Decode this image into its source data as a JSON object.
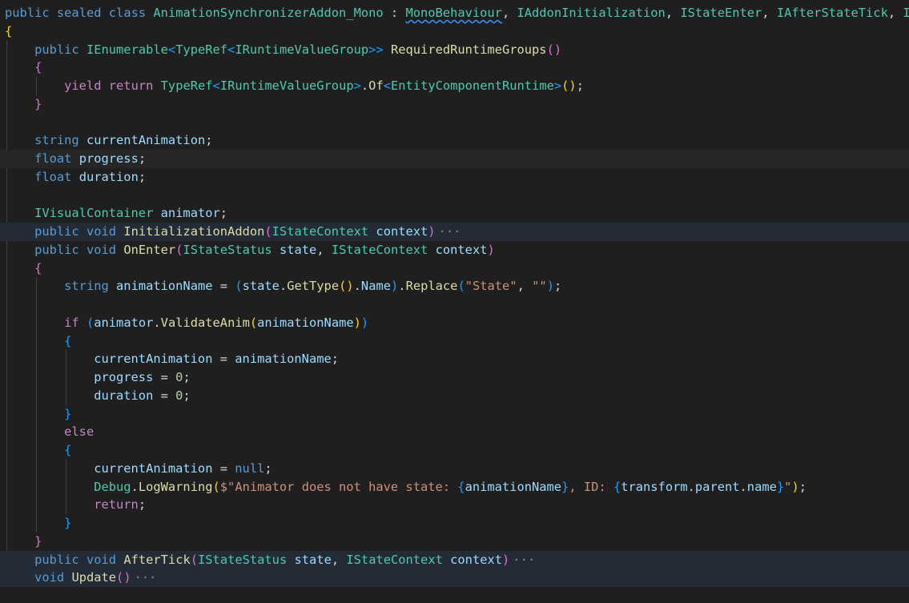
{
  "colors": {
    "keyword": "#569cd6",
    "control": "#c586c0",
    "type": "#4ec9b0",
    "method": "#dcdcaa",
    "variable": "#9cdcfe",
    "plain": "#d4d4d4",
    "string": "#ce9178",
    "number": "#b5cea8",
    "punct": "#d4d4d4",
    "brace1": "#ffd700",
    "brace2": "#da70d6",
    "brace3": "#179fff",
    "fold": "#8c8c8c",
    "background": "#1f1f1f"
  },
  "lines": [
    {
      "hl": "",
      "tokens": [
        [
          "keyword",
          "public"
        ],
        [
          "plain",
          " "
        ],
        [
          "keyword",
          "sealed"
        ],
        [
          "plain",
          " "
        ],
        [
          "keyword",
          "class"
        ],
        [
          "plain",
          " "
        ],
        [
          "type",
          "AnimationSynchronizerAddon_Mono"
        ],
        [
          "plain",
          " : "
        ],
        [
          "type",
          "MonoBehaviour",
          "squiggle"
        ],
        [
          "plain",
          ", "
        ],
        [
          "type",
          "IAddonInitialization"
        ],
        [
          "plain",
          ", "
        ],
        [
          "type",
          "IStateEnter"
        ],
        [
          "plain",
          ", "
        ],
        [
          "type",
          "IAfterStateTick"
        ],
        [
          "plain",
          ", "
        ],
        [
          "type",
          "I"
        ]
      ]
    },
    {
      "hl": "",
      "tokens": [
        [
          "brace1",
          "{"
        ]
      ]
    },
    {
      "hl": "",
      "tokens": [
        [
          "plain",
          "    "
        ],
        [
          "keyword",
          "public"
        ],
        [
          "plain",
          " "
        ],
        [
          "type",
          "IEnumerable"
        ],
        [
          "brace3",
          "<"
        ],
        [
          "type",
          "TypeRef"
        ],
        [
          "brace3",
          "<"
        ],
        [
          "type",
          "IRuntimeValueGroup"
        ],
        [
          "brace3",
          ">>"
        ],
        [
          "plain",
          " "
        ],
        [
          "method",
          "RequiredRuntimeGroups"
        ],
        [
          "brace2",
          "()"
        ]
      ]
    },
    {
      "hl": "",
      "tokens": [
        [
          "plain",
          "    "
        ],
        [
          "brace2",
          "{"
        ]
      ]
    },
    {
      "hl": "",
      "tokens": [
        [
          "plain",
          "        "
        ],
        [
          "control",
          "yield"
        ],
        [
          "plain",
          " "
        ],
        [
          "control",
          "return"
        ],
        [
          "plain",
          " "
        ],
        [
          "type",
          "TypeRef"
        ],
        [
          "brace3",
          "<"
        ],
        [
          "type",
          "IRuntimeValueGroup"
        ],
        [
          "brace3",
          ">"
        ],
        [
          "plain",
          "."
        ],
        [
          "method",
          "Of"
        ],
        [
          "brace3",
          "<"
        ],
        [
          "type",
          "EntityComponentRuntime"
        ],
        [
          "brace3",
          ">"
        ],
        [
          "brace1",
          "()"
        ],
        [
          "plain",
          ";"
        ]
      ]
    },
    {
      "hl": "",
      "tokens": [
        [
          "plain",
          "    "
        ],
        [
          "brace2",
          "}"
        ]
      ]
    },
    {
      "hl": "",
      "tokens": []
    },
    {
      "hl": "",
      "tokens": [
        [
          "plain",
          "    "
        ],
        [
          "keyword",
          "string"
        ],
        [
          "plain",
          " "
        ],
        [
          "variable",
          "currentAnimation"
        ],
        [
          "plain",
          ";"
        ]
      ]
    },
    {
      "hl": "hl2",
      "tokens": [
        [
          "plain",
          "    "
        ],
        [
          "keyword",
          "float"
        ],
        [
          "plain",
          " "
        ],
        [
          "variable",
          "progress"
        ],
        [
          "plain",
          ";"
        ]
      ]
    },
    {
      "hl": "",
      "tokens": [
        [
          "plain",
          "    "
        ],
        [
          "keyword",
          "float"
        ],
        [
          "plain",
          " "
        ],
        [
          "variable",
          "duration"
        ],
        [
          "plain",
          ";"
        ]
      ]
    },
    {
      "hl": "",
      "tokens": []
    },
    {
      "hl": "",
      "tokens": [
        [
          "plain",
          "    "
        ],
        [
          "type",
          "IVisualContainer"
        ],
        [
          "plain",
          " "
        ],
        [
          "variable",
          "animator"
        ],
        [
          "plain",
          ";"
        ]
      ]
    },
    {
      "hl": "hl",
      "tokens": [
        [
          "plain",
          "    "
        ],
        [
          "keyword",
          "public"
        ],
        [
          "plain",
          " "
        ],
        [
          "keyword",
          "void"
        ],
        [
          "plain",
          " "
        ],
        [
          "method",
          "InitializationAddon"
        ],
        [
          "brace2",
          "("
        ],
        [
          "type",
          "IStateContext"
        ],
        [
          "plain",
          " "
        ],
        [
          "variable",
          "context"
        ],
        [
          "brace2",
          ")"
        ],
        [
          "fold",
          "···"
        ]
      ]
    },
    {
      "hl": "",
      "tokens": [
        [
          "plain",
          "    "
        ],
        [
          "keyword",
          "public"
        ],
        [
          "plain",
          " "
        ],
        [
          "keyword",
          "void"
        ],
        [
          "plain",
          " "
        ],
        [
          "method",
          "OnEnter"
        ],
        [
          "brace2",
          "("
        ],
        [
          "type",
          "IStateStatus"
        ],
        [
          "plain",
          " "
        ],
        [
          "variable",
          "state"
        ],
        [
          "plain",
          ", "
        ],
        [
          "type",
          "IStateContext"
        ],
        [
          "plain",
          " "
        ],
        [
          "variable",
          "context"
        ],
        [
          "brace2",
          ")"
        ]
      ]
    },
    {
      "hl": "",
      "tokens": [
        [
          "plain",
          "    "
        ],
        [
          "brace2",
          "{"
        ]
      ]
    },
    {
      "hl": "",
      "tokens": [
        [
          "plain",
          "        "
        ],
        [
          "keyword",
          "string"
        ],
        [
          "plain",
          " "
        ],
        [
          "variable",
          "animationName"
        ],
        [
          "plain",
          " = "
        ],
        [
          "brace3",
          "("
        ],
        [
          "variable",
          "state"
        ],
        [
          "plain",
          "."
        ],
        [
          "method",
          "GetType"
        ],
        [
          "brace1",
          "()"
        ],
        [
          "plain",
          "."
        ],
        [
          "variable",
          "Name"
        ],
        [
          "brace3",
          ")"
        ],
        [
          "plain",
          "."
        ],
        [
          "method",
          "Replace"
        ],
        [
          "brace3",
          "("
        ],
        [
          "string",
          "\"State\""
        ],
        [
          "plain",
          ", "
        ],
        [
          "string",
          "\"\""
        ],
        [
          "brace3",
          ")"
        ],
        [
          "plain",
          ";"
        ]
      ]
    },
    {
      "hl": "",
      "tokens": []
    },
    {
      "hl": "",
      "tokens": [
        [
          "plain",
          "        "
        ],
        [
          "control",
          "if"
        ],
        [
          "plain",
          " "
        ],
        [
          "brace3",
          "("
        ],
        [
          "variable",
          "animator"
        ],
        [
          "plain",
          "."
        ],
        [
          "method",
          "ValidateAnim"
        ],
        [
          "brace1",
          "("
        ],
        [
          "variable",
          "animationName"
        ],
        [
          "brace1",
          ")"
        ],
        [
          "brace3",
          ")"
        ]
      ]
    },
    {
      "hl": "",
      "tokens": [
        [
          "plain",
          "        "
        ],
        [
          "brace3",
          "{"
        ]
      ]
    },
    {
      "hl": "",
      "tokens": [
        [
          "plain",
          "            "
        ],
        [
          "variable",
          "currentAnimation"
        ],
        [
          "plain",
          " = "
        ],
        [
          "variable",
          "animationName"
        ],
        [
          "plain",
          ";"
        ]
      ]
    },
    {
      "hl": "",
      "tokens": [
        [
          "plain",
          "            "
        ],
        [
          "variable",
          "progress"
        ],
        [
          "plain",
          " = "
        ],
        [
          "number",
          "0"
        ],
        [
          "plain",
          ";"
        ]
      ]
    },
    {
      "hl": "",
      "tokens": [
        [
          "plain",
          "            "
        ],
        [
          "variable",
          "duration"
        ],
        [
          "plain",
          " = "
        ],
        [
          "number",
          "0"
        ],
        [
          "plain",
          ";"
        ]
      ]
    },
    {
      "hl": "",
      "tokens": [
        [
          "plain",
          "        "
        ],
        [
          "brace3",
          "}"
        ]
      ]
    },
    {
      "hl": "",
      "tokens": [
        [
          "plain",
          "        "
        ],
        [
          "control",
          "else"
        ]
      ]
    },
    {
      "hl": "",
      "tokens": [
        [
          "plain",
          "        "
        ],
        [
          "brace3",
          "{"
        ]
      ]
    },
    {
      "hl": "",
      "tokens": [
        [
          "plain",
          "            "
        ],
        [
          "variable",
          "currentAnimation"
        ],
        [
          "plain",
          " = "
        ],
        [
          "keyword",
          "null"
        ],
        [
          "plain",
          ";"
        ]
      ]
    },
    {
      "hl": "",
      "tokens": [
        [
          "plain",
          "            "
        ],
        [
          "type",
          "Debug"
        ],
        [
          "plain",
          "."
        ],
        [
          "method",
          "LogWarning"
        ],
        [
          "brace1",
          "("
        ],
        [
          "string",
          "$\"Animator does not have state: "
        ],
        [
          "brace3",
          "{"
        ],
        [
          "variable",
          "animationName"
        ],
        [
          "brace3",
          "}"
        ],
        [
          "string",
          ", ID: "
        ],
        [
          "brace3",
          "{"
        ],
        [
          "variable",
          "transform"
        ],
        [
          "plain",
          "."
        ],
        [
          "variable",
          "parent"
        ],
        [
          "plain",
          "."
        ],
        [
          "variable",
          "name"
        ],
        [
          "brace3",
          "}"
        ],
        [
          "string",
          "\""
        ],
        [
          "brace1",
          ")"
        ],
        [
          "plain",
          ";"
        ]
      ]
    },
    {
      "hl": "",
      "tokens": [
        [
          "plain",
          "            "
        ],
        [
          "control",
          "return"
        ],
        [
          "plain",
          ";"
        ]
      ]
    },
    {
      "hl": "",
      "tokens": [
        [
          "plain",
          "        "
        ],
        [
          "brace3",
          "}"
        ]
      ]
    },
    {
      "hl": "",
      "tokens": [
        [
          "plain",
          "    "
        ],
        [
          "brace2",
          "}"
        ]
      ]
    },
    {
      "hl": "hl",
      "tokens": [
        [
          "plain",
          "    "
        ],
        [
          "keyword",
          "public"
        ],
        [
          "plain",
          " "
        ],
        [
          "keyword",
          "void"
        ],
        [
          "plain",
          " "
        ],
        [
          "method",
          "AfterTick"
        ],
        [
          "brace2",
          "("
        ],
        [
          "type",
          "IStateStatus"
        ],
        [
          "plain",
          " "
        ],
        [
          "variable",
          "state"
        ],
        [
          "plain",
          ", "
        ],
        [
          "type",
          "IStateContext"
        ],
        [
          "plain",
          " "
        ],
        [
          "variable",
          "context"
        ],
        [
          "brace2",
          ")"
        ],
        [
          "fold",
          "···"
        ]
      ]
    },
    {
      "hl": "hl",
      "tokens": [
        [
          "plain",
          "    "
        ],
        [
          "keyword",
          "void"
        ],
        [
          "plain",
          " "
        ],
        [
          "method",
          "Update"
        ],
        [
          "brace2",
          "()"
        ],
        [
          "fold",
          "···"
        ]
      ]
    }
  ]
}
